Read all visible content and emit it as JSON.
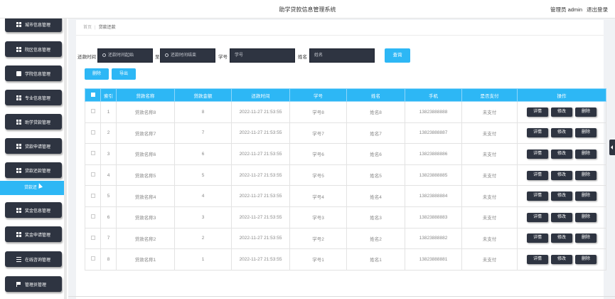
{
  "header": {
    "title": "助学贷款信息管理系统",
    "user": "管理员 admin",
    "logout": "退出登录"
  },
  "sidebar": {
    "items": [
      {
        "label": "城市信息管理",
        "icon": "grid-icon"
      },
      {
        "label": "院区信息管理",
        "icon": "grid-icon"
      },
      {
        "label": "学院信息管理",
        "icon": "book-icon"
      },
      {
        "label": "专业信息管理",
        "icon": "grid-icon"
      },
      {
        "label": "助学贷款管理",
        "icon": "grid-icon"
      },
      {
        "label": "贷款申请管理",
        "icon": "grid-icon"
      },
      {
        "label": "贷款还款管理",
        "icon": "grid-icon"
      },
      {
        "label": "奖金信息管理",
        "icon": "grid-icon"
      },
      {
        "label": "奖金申请管理",
        "icon": "grid-icon"
      },
      {
        "label": "在线咨询管理",
        "icon": "lines-icon"
      },
      {
        "label": "管理员管理",
        "icon": "flag-icon"
      }
    ],
    "active_sub": "贷款还"
  },
  "breadcrumb": {
    "home": "首页",
    "current": "贷款还款"
  },
  "search": {
    "time_label": "还款时间",
    "start_placeholder": "还款时间起始",
    "to_label": "至",
    "end_placeholder": "还款时间结束",
    "sid_label": "学号",
    "sid_placeholder": "学号",
    "name_label": "姓名",
    "name_placeholder": "姓名",
    "query": "查询"
  },
  "actions": {
    "delete": "删除",
    "export": "导出"
  },
  "table": {
    "headers": [
      "索引",
      "贷款名称",
      "贷款金额",
      "还款时间",
      "学号",
      "姓名",
      "手机",
      "是否支付",
      "操作"
    ],
    "rows": [
      {
        "idx": "1",
        "name": "贷款名称8",
        "amount": "8",
        "time": "2022-11-27 21:53:55",
        "sid": "学号8",
        "sname": "姓名8",
        "phone": "13823888888",
        "paid": "未支付"
      },
      {
        "idx": "2",
        "name": "贷款名称7",
        "amount": "7",
        "time": "2022-11-27 21:53:55",
        "sid": "学号7",
        "sname": "姓名7",
        "phone": "13823888887",
        "paid": "未支付"
      },
      {
        "idx": "3",
        "name": "贷款名称6",
        "amount": "6",
        "time": "2022-11-27 21:53:55",
        "sid": "学号6",
        "sname": "姓名6",
        "phone": "13823888886",
        "paid": "未支付"
      },
      {
        "idx": "4",
        "name": "贷款名称5",
        "amount": "5",
        "time": "2022-11-27 21:53:55",
        "sid": "学号5",
        "sname": "姓名5",
        "phone": "13823888885",
        "paid": "未支付"
      },
      {
        "idx": "5",
        "name": "贷款名称4",
        "amount": "4",
        "time": "2022-11-27 21:53:55",
        "sid": "学号4",
        "sname": "姓名4",
        "phone": "13823888884",
        "paid": "未支付"
      },
      {
        "idx": "6",
        "name": "贷款名称3",
        "amount": "3",
        "time": "2022-11-27 21:53:55",
        "sid": "学号3",
        "sname": "姓名3",
        "phone": "13823888883",
        "paid": "未支付"
      },
      {
        "idx": "7",
        "name": "贷款名称2",
        "amount": "2",
        "time": "2022-11-27 21:53:55",
        "sid": "学号2",
        "sname": "姓名2",
        "phone": "13823888882",
        "paid": "未支付"
      },
      {
        "idx": "8",
        "name": "贷款名称1",
        "amount": "1",
        "time": "2022-11-27 21:53:55",
        "sid": "学号1",
        "sname": "姓名1",
        "phone": "13823888881",
        "paid": "未支付"
      }
    ],
    "ops": {
      "detail": "详情",
      "edit": "修改",
      "delete": "删除"
    }
  },
  "colors": {
    "accent": "#2db7f5",
    "dark_button": "#2e3441"
  }
}
